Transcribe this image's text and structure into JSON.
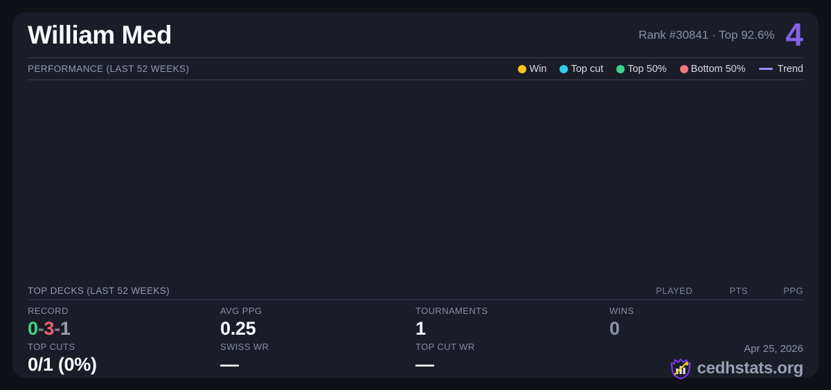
{
  "header": {
    "title": "William Med",
    "rank_text": "Rank #30841  ·  Top 92.6%",
    "big_number": "4"
  },
  "performance": {
    "section_title": "PERFORMANCE (LAST 52 WEEKS)",
    "legend": [
      {
        "label": "Win",
        "color": "#f2c51d",
        "shape": "dot"
      },
      {
        "label": "Top cut",
        "color": "#2fd0ea",
        "shape": "dot"
      },
      {
        "label": "Top 50%",
        "color": "#3bd68c",
        "shape": "dot"
      },
      {
        "label": "Bottom 50%",
        "color": "#f0747c",
        "shape": "dot"
      },
      {
        "label": "Trend",
        "color": "#a78bfa",
        "shape": "line"
      }
    ]
  },
  "top_decks": {
    "section_title": "TOP DECKS (LAST 52 WEEKS)",
    "columns": [
      "PLAYED",
      "PTS",
      "PPG"
    ]
  },
  "stats": {
    "record": {
      "label": "RECORD",
      "wins": "0",
      "losses": "3",
      "draws": "1",
      "sep": "-"
    },
    "avg_ppg": {
      "label": "AVG PPG",
      "value": "0.25"
    },
    "tournaments": {
      "label": "TOURNAMENTS",
      "value": "1"
    },
    "wins": {
      "label": "WINS",
      "value": "0"
    },
    "top_cuts": {
      "label": "TOP CUTS",
      "value": "0/1 (0%)"
    },
    "swiss_wr": {
      "label": "SWISS WR",
      "value": "—"
    },
    "top_cut_wr": {
      "label": "TOP CUT WR",
      "value": "—"
    }
  },
  "footer": {
    "date": "Apr 25, 2026",
    "brand": "cedhstats.org"
  },
  "colors": {
    "accent_purple": "#8463e4",
    "record_win_green": "#42d77d",
    "record_loss_red": "#f0636b",
    "record_draw_gray": "#9aa1ae",
    "dim_value_gray": "#8b92a0",
    "logo_purple": "#7c3aed",
    "logo_yellow": "#f2c51d"
  }
}
